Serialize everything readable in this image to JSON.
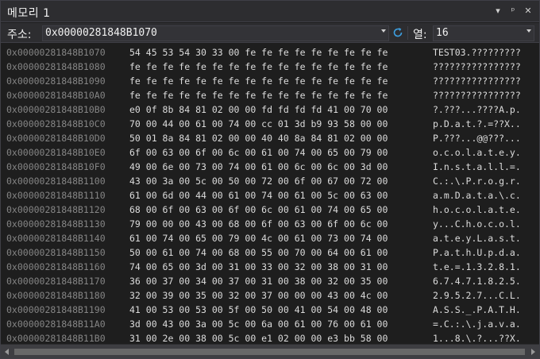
{
  "window": {
    "title": "메모리 1",
    "btn_menu": "▾",
    "btn_pin": "ᵖ",
    "btn_close": "✕"
  },
  "toolbar": {
    "address_label": "주소:",
    "address_value": "0x00000281848B1070",
    "columns_label": "열:",
    "columns_value": "16"
  },
  "rows": [
    {
      "addr": "0x00000281848B1070",
      "hex": "54 45 53 54 30 33 00 fe fe fe fe fe fe fe fe fe",
      "ascii": "TEST03.?????????"
    },
    {
      "addr": "0x00000281848B1080",
      "hex": "fe fe fe fe fe fe fe fe fe fe fe fe fe fe fe fe",
      "ascii": "????????????????"
    },
    {
      "addr": "0x00000281848B1090",
      "hex": "fe fe fe fe fe fe fe fe fe fe fe fe fe fe fe fe",
      "ascii": "????????????????"
    },
    {
      "addr": "0x00000281848B10A0",
      "hex": "fe fe fe fe fe fe fe fe fe fe fe fe fe fe fe fe",
      "ascii": "????????????????"
    },
    {
      "addr": "0x00000281848B10B0",
      "hex": "e0 0f 8b 84 81 02 00 00 fd fd fd fd 41 00 70 00",
      "ascii": "?.???...????A.p."
    },
    {
      "addr": "0x00000281848B10C0",
      "hex": "70 00 44 00 61 00 74 00 cc 01 3d b9 93 58 00 00",
      "ascii": "p.D.a.t.?.=??X.."
    },
    {
      "addr": "0x00000281848B10D0",
      "hex": "50 01 8a 84 81 02 00 00 40 40 8a 84 81 02 00 00",
      "ascii": "P.???...@@???..."
    },
    {
      "addr": "0x00000281848B10E0",
      "hex": "6f 00 63 00 6f 00 6c 00 61 00 74 00 65 00 79 00",
      "ascii": "o.c.o.l.a.t.e.y."
    },
    {
      "addr": "0x00000281848B10F0",
      "hex": "49 00 6e 00 73 00 74 00 61 00 6c 00 6c 00 3d 00",
      "ascii": "I.n.s.t.a.l.l.=."
    },
    {
      "addr": "0x00000281848B1100",
      "hex": "43 00 3a 00 5c 00 50 00 72 00 6f 00 67 00 72 00",
      "ascii": "C.:.\\.P.r.o.g.r."
    },
    {
      "addr": "0x00000281848B1110",
      "hex": "61 00 6d 00 44 00 61 00 74 00 61 00 5c 00 63 00",
      "ascii": "a.m.D.a.t.a.\\.c."
    },
    {
      "addr": "0x00000281848B1120",
      "hex": "68 00 6f 00 63 00 6f 00 6c 00 61 00 74 00 65 00",
      "ascii": "h.o.c.o.l.a.t.e."
    },
    {
      "addr": "0x00000281848B1130",
      "hex": "79 00 00 00 43 00 68 00 6f 00 63 00 6f 00 6c 00",
      "ascii": "y...C.h.o.c.o.l."
    },
    {
      "addr": "0x00000281848B1140",
      "hex": "61 00 74 00 65 00 79 00 4c 00 61 00 73 00 74 00",
      "ascii": "a.t.e.y.L.a.s.t."
    },
    {
      "addr": "0x00000281848B1150",
      "hex": "50 00 61 00 74 00 68 00 55 00 70 00 64 00 61 00",
      "ascii": "P.a.t.h.U.p.d.a."
    },
    {
      "addr": "0x00000281848B1160",
      "hex": "74 00 65 00 3d 00 31 00 33 00 32 00 38 00 31 00",
      "ascii": "t.e.=.1.3.2.8.1."
    },
    {
      "addr": "0x00000281848B1170",
      "hex": "36 00 37 00 34 00 37 00 31 00 38 00 32 00 35 00",
      "ascii": "6.7.4.7.1.8.2.5."
    },
    {
      "addr": "0x00000281848B1180",
      "hex": "32 00 39 00 35 00 32 00 37 00 00 00 43 00 4c 00",
      "ascii": "2.9.5.2.7...C.L."
    },
    {
      "addr": "0x00000281848B1190",
      "hex": "41 00 53 00 53 00 5f 00 50 00 41 00 54 00 48 00",
      "ascii": "A.S.S._.P.A.T.H."
    },
    {
      "addr": "0x00000281848B11A0",
      "hex": "3d 00 43 00 3a 00 5c 00 6a 00 61 00 76 00 61 00",
      "ascii": "=.C.:.\\.j.a.v.a."
    },
    {
      "addr": "0x00000281848B11B0",
      "hex": "31 00 2e 00 38 00 5c 00 e1 02 00 00 e3 bb 58 00",
      "ascii": "1...8.\\.?...??X."
    }
  ]
}
